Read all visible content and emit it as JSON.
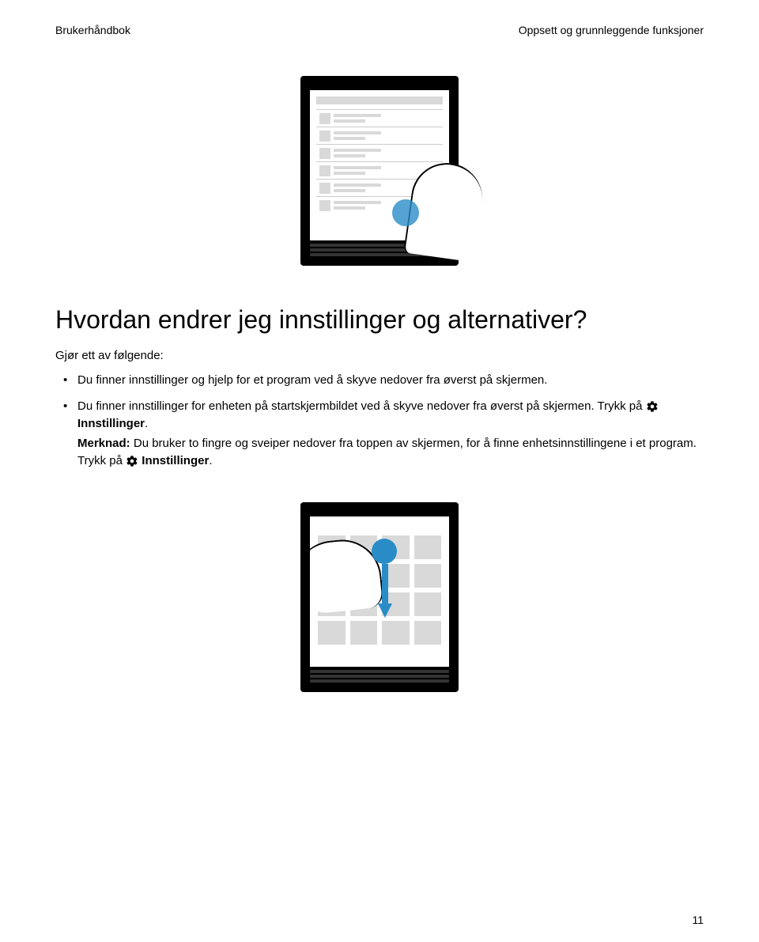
{
  "header": {
    "left": "Brukerhåndbok",
    "right": "Oppsett og grunnleggende funksjoner"
  },
  "heading": "Hvordan endrer jeg innstillinger og alternativer?",
  "lead": "Gjør ett av følgende:",
  "bullets": {
    "b1": "Du finner innstillinger og hjelp for et program ved å skyve nedover fra øverst på skjermen.",
    "b2a": "Du finner innstillinger for enheten på startskjermbildet ved å skyve nedover fra øverst på skjermen. Trykk på ",
    "b2b": "Innstillinger",
    "b2c": ".",
    "b3_label": "Merknad:",
    "b3a": " Du bruker to fingre og sveiper nedover fra toppen av skjermen, for å finne enhetsinnstillingene i et program. Trykk på ",
    "b3b": "Innstillinger",
    "b3c": "."
  },
  "page_number": "11"
}
